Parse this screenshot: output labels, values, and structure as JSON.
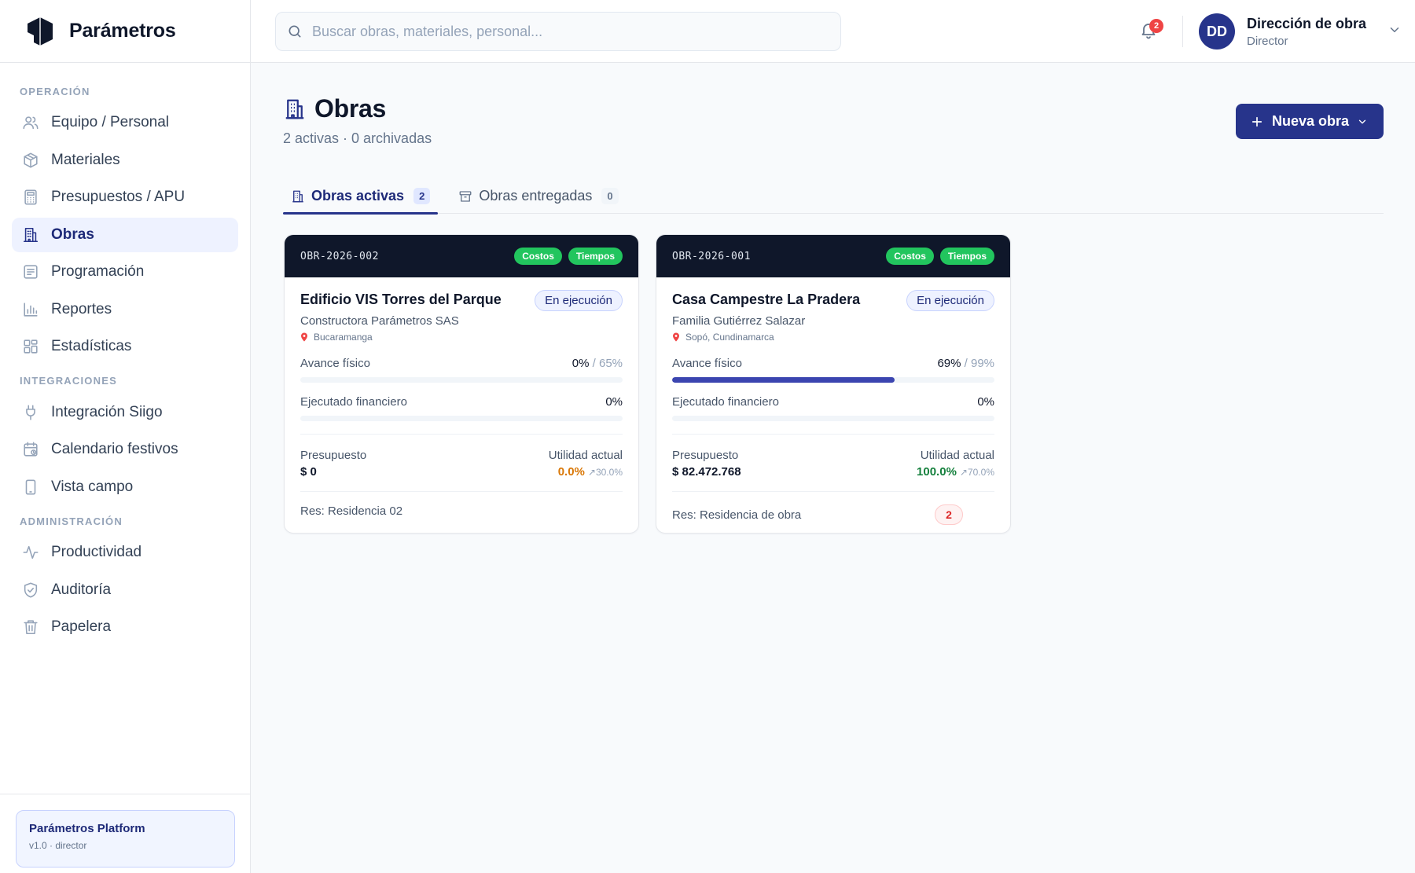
{
  "brand": {
    "name": "Parámetros"
  },
  "sidebar": {
    "sections": [
      {
        "title": "OPERACIÓN",
        "items": [
          {
            "label": "Equipo / Personal",
            "icon": "users-icon"
          },
          {
            "label": "Materiales",
            "icon": "box-icon"
          },
          {
            "label": "Presupuestos / APU",
            "icon": "calculator-icon"
          },
          {
            "label": "Obras",
            "icon": "building-icon",
            "active": true
          },
          {
            "label": "Programación",
            "icon": "schedule-icon"
          },
          {
            "label": "Reportes",
            "icon": "bar-chart-icon"
          },
          {
            "label": "Estadísticas",
            "icon": "dashboard-icon"
          }
        ]
      },
      {
        "title": "INTEGRACIONES",
        "items": [
          {
            "label": "Integración Siigo",
            "icon": "plug-icon"
          },
          {
            "label": "Calendario festivos",
            "icon": "calendar-icon"
          },
          {
            "label": "Vista campo",
            "icon": "phone-icon"
          }
        ]
      },
      {
        "title": "ADMINISTRACIÓN",
        "items": [
          {
            "label": "Productividad",
            "icon": "activity-icon"
          },
          {
            "label": "Auditoría",
            "icon": "shield-icon"
          },
          {
            "label": "Papelera",
            "icon": "trash-icon"
          }
        ]
      }
    ],
    "footer": {
      "title": "Parámetros Platform",
      "subtitle": "v1.0 · director"
    }
  },
  "topbar": {
    "search_placeholder": "Buscar obras, materiales, personal...",
    "notifications_count": "2",
    "user": {
      "initials": "DD",
      "name": "Dirección de obra",
      "role": "Director"
    }
  },
  "page": {
    "title": "Obras",
    "subtitle": "2 activas · 0 archivadas",
    "new_button": "Nueva obra"
  },
  "tabs": [
    {
      "label": "Obras activas",
      "count": "2",
      "active": true
    },
    {
      "label": "Obras entregadas",
      "count": "0",
      "active": false
    }
  ],
  "colors": {
    "primary": "#27348b",
    "header_dark": "#0f172a",
    "chip_green": "#22c55e",
    "util_orange": "#d97706",
    "util_green": "#15803d"
  },
  "cards": [
    {
      "code": "OBR-2026-002",
      "chips": [
        "Costos",
        "Tiempos"
      ],
      "title": "Edificio VIS Torres del Parque",
      "status": "En ejecución",
      "client": "Constructora Parámetros SAS",
      "location": "Bucaramanga",
      "progress_label": "Avance físico",
      "progress_value": "0%",
      "progress_target": " / 65%",
      "progress_fraction": 0.0,
      "financial_label": "Ejecutado financiero",
      "financial_value": "0%",
      "financial_fraction": 0.0,
      "budget_label": "Presupuesto",
      "budget_value": "$ 0",
      "utility_label": "Utilidad actual",
      "utility_value": "0.0%",
      "utility_trend": "↗30.0%",
      "utility_color": "orange",
      "resident": "Res: Residencia 02",
      "alerts": ""
    },
    {
      "code": "OBR-2026-001",
      "chips": [
        "Costos",
        "Tiempos"
      ],
      "title": "Casa Campestre La Pradera",
      "status": "En ejecución",
      "client": "Familia Gutiérrez Salazar",
      "location": "Sopó, Cundinamarca",
      "progress_label": "Avance físico",
      "progress_value": "69%",
      "progress_target": " / 99%",
      "progress_fraction": 0.69,
      "financial_label": "Ejecutado financiero",
      "financial_value": "0%",
      "financial_fraction": 0.0,
      "budget_label": "Presupuesto",
      "budget_value": "$ 82.472.768",
      "utility_label": "Utilidad actual",
      "utility_value": "100.0%",
      "utility_trend": "↗70.0%",
      "utility_color": "green",
      "resident": "Res: Residencia de obra",
      "alerts": "2"
    }
  ]
}
